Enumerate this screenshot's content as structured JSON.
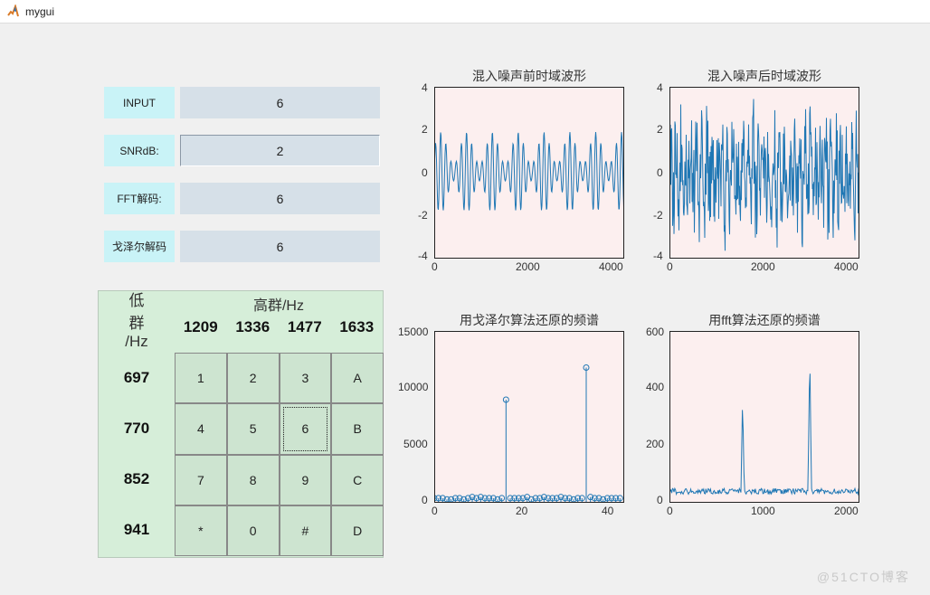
{
  "window": {
    "title": "mygui"
  },
  "fields": {
    "input": {
      "label": "INPUT",
      "value": "6"
    },
    "snr": {
      "label": "SNRdB:",
      "value": "2"
    },
    "fft": {
      "label": "FFT解码:",
      "value": "6"
    },
    "goertzel": {
      "label": "戈泽尔解码",
      "value": "6"
    }
  },
  "table": {
    "corner_row1": "低",
    "corner_row2": "群",
    "corner_row3": "/Hz",
    "header": "高群/Hz",
    "col_headers": [
      "1209",
      "1336",
      "1477",
      "1633"
    ],
    "row_headers": [
      "697",
      "770",
      "852",
      "941"
    ],
    "keys": [
      [
        "1",
        "2",
        "3",
        "A"
      ],
      [
        "4",
        "5",
        "6",
        "B"
      ],
      [
        "7",
        "8",
        "9",
        "C"
      ],
      [
        "*",
        "0",
        "#",
        "D"
      ]
    ],
    "pressed": "6"
  },
  "charts": {
    "tl": {
      "title": "混入噪声前时域波形",
      "xticks": [
        "0",
        "2000",
        "4000"
      ],
      "yticks": [
        "-4",
        "-2",
        "0",
        "2",
        "4"
      ]
    },
    "tr": {
      "title": "混入噪声后时域波形",
      "xticks": [
        "0",
        "2000",
        "4000"
      ],
      "yticks": [
        "-4",
        "-2",
        "0",
        "2",
        "4"
      ]
    },
    "bl": {
      "title": "用戈泽尔算法还原的频谱",
      "xticks": [
        "0",
        "20",
        "40"
      ],
      "yticks": [
        "0",
        "5000",
        "10000",
        "15000"
      ]
    },
    "br": {
      "title": "用fft算法还原的频谱",
      "xticks": [
        "0",
        "1000",
        "2000"
      ],
      "yticks": [
        "0",
        "200",
        "400",
        "600"
      ]
    }
  },
  "chart_data": [
    {
      "type": "line",
      "title": "混入噪声前时域波形",
      "x_range": [
        0,
        4000
      ],
      "y_range": [
        -4,
        4
      ],
      "description": "clean DTMF dual-tone (key 6) waveform, amplitude roughly ±2",
      "series": [
        {
          "name": "signal",
          "amplitude": 2,
          "samples": 4000
        }
      ]
    },
    {
      "type": "line",
      "title": "混入噪声后时域波形",
      "x_range": [
        0,
        4000
      ],
      "y_range": [
        -4,
        4
      ],
      "description": "DTMF tone with additive noise at SNR 2 dB, peaks touching ±4",
      "series": [
        {
          "name": "signal+noise",
          "amplitude": 4,
          "samples": 4000
        }
      ]
    },
    {
      "type": "stem",
      "title": "用戈泽尔算法还原的频谱",
      "x_range": [
        0,
        45
      ],
      "y_range": [
        0,
        15000
      ],
      "x": [
        0,
        1,
        2,
        3,
        4,
        5,
        6,
        7,
        8,
        9,
        10,
        11,
        12,
        13,
        14,
        15,
        16,
        17,
        18,
        19,
        20,
        21,
        22,
        23,
        24,
        25,
        26,
        27,
        28,
        29,
        30,
        31,
        32,
        33,
        34,
        35,
        36,
        37,
        38,
        39,
        40,
        41,
        42,
        43,
        44
      ],
      "y": [
        400,
        400,
        400,
        300,
        300,
        400,
        400,
        300,
        400,
        500,
        400,
        500,
        400,
        400,
        400,
        300,
        400,
        9000,
        400,
        400,
        400,
        400,
        500,
        300,
        400,
        400,
        500,
        400,
        400,
        400,
        500,
        400,
        400,
        300,
        400,
        400,
        11800,
        500,
        400,
        400,
        300,
        400,
        400,
        400,
        400
      ],
      "note": "two dominant bins ≈17 and ≈36 correspond to 770 Hz and 1477 Hz (key 6)"
    },
    {
      "type": "line",
      "title": "用fft算法还原的频谱",
      "x_range": [
        0,
        2000
      ],
      "y_range": [
        0,
        600
      ],
      "peaks": [
        {
          "freq": 770,
          "mag": 360
        },
        {
          "freq": 1477,
          "mag": 530
        }
      ],
      "floor": 30
    }
  ],
  "watermark": "@51CTO博客"
}
